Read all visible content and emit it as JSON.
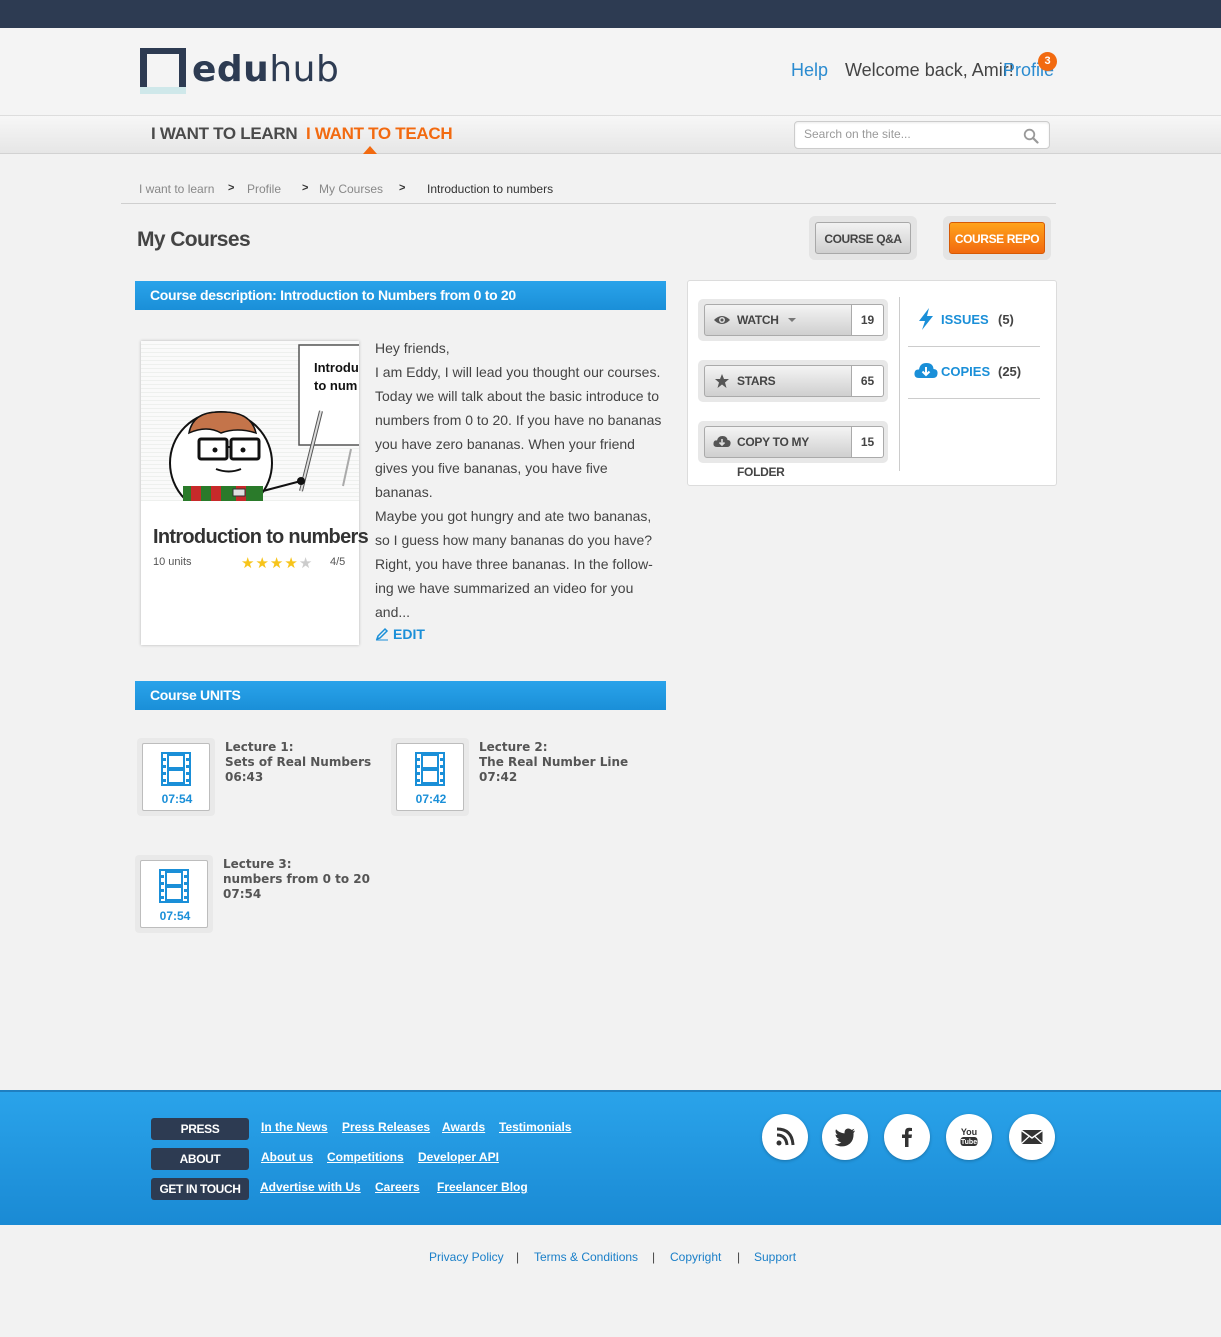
{
  "brand": {
    "logo_bold": "edu",
    "logo_light": "hub"
  },
  "header": {
    "help": "Help",
    "welcome": "Welcome back, Amir!",
    "profile": "Profile",
    "profile_badge": "3"
  },
  "nav": {
    "learn": "I WANT TO LEARN",
    "teach": "I WANT TO TEACH",
    "search_placeholder": "Search on the site..."
  },
  "breadcrumb": [
    "I want to learn",
    "Profile",
    "My Courses",
    "Introduction to numbers"
  ],
  "page": {
    "title": "My Courses",
    "qa_button": "COURSE Q&A",
    "repo_button": "COURSE REPO"
  },
  "course": {
    "section_title": "Course description: Introduction to Numbers from 0 to 20",
    "card_title": "Introduction to numbers",
    "units": "10 units",
    "rating_stars": 4,
    "rating_max": 5,
    "rating_text": "4/5",
    "image_text": "Introduction to numbers",
    "description": [
      "Hey friends,",
      "I am Eddy, I will lead you thought our courses. Today we will talk about the basic introduce to numbers from 0 to 20. If you have no bananas you have zero bananas. When your friend gives you five bananas, you have five bananas.",
      "Maybe you got hungry and ate two bananas, so I guess how many bananas do you have? Right, you have three bananas. In the follow-ing we have summarized an video for you and..."
    ],
    "edit": "EDIT"
  },
  "stats": {
    "watch": {
      "label": "WATCH",
      "count": "19"
    },
    "stars": {
      "label": "STARS",
      "count": "65"
    },
    "copy": {
      "label": "COPY TO MY FOLDER",
      "count": "15"
    },
    "issues": {
      "label": "ISSUES",
      "count": "(5)"
    },
    "copies": {
      "label": "COPIES",
      "count": "(25)"
    }
  },
  "units_section": {
    "title": "Course UNITS",
    "units": [
      {
        "lecture": "Lecture 1:",
        "name": "Sets of Real Numbers",
        "time": "06:43",
        "duration": "07:54"
      },
      {
        "lecture": "Lecture 2:",
        "name": "The Real Number Line",
        "time": "07:42",
        "duration": "07:42"
      },
      {
        "lecture": "Lecture 3:",
        "name": "numbers from 0 to 20",
        "time": "07:54",
        "duration": "07:54"
      }
    ]
  },
  "footer": {
    "press": "PRESS",
    "about": "ABOUT",
    "touch": "GET IN TOUCH",
    "press_links": [
      "In the News",
      "Press Releases",
      "Awards",
      "Testimonials"
    ],
    "about_links": [
      "About us",
      "Competitions",
      "Developer API"
    ],
    "touch_links": [
      "Advertise with Us",
      "Careers",
      "Freelancer Blog"
    ],
    "social": [
      "rss-icon",
      "twitter-icon",
      "facebook-icon",
      "youtube-icon",
      "mail-icon"
    ]
  },
  "bottom": {
    "links": [
      "Privacy Policy",
      "Terms & Conditions",
      "Copyright",
      "Support"
    ],
    "separator": "|"
  },
  "colors": {
    "accent": "#1a8fd8",
    "orange": "#f26a10",
    "dark": "#2d3b52"
  }
}
